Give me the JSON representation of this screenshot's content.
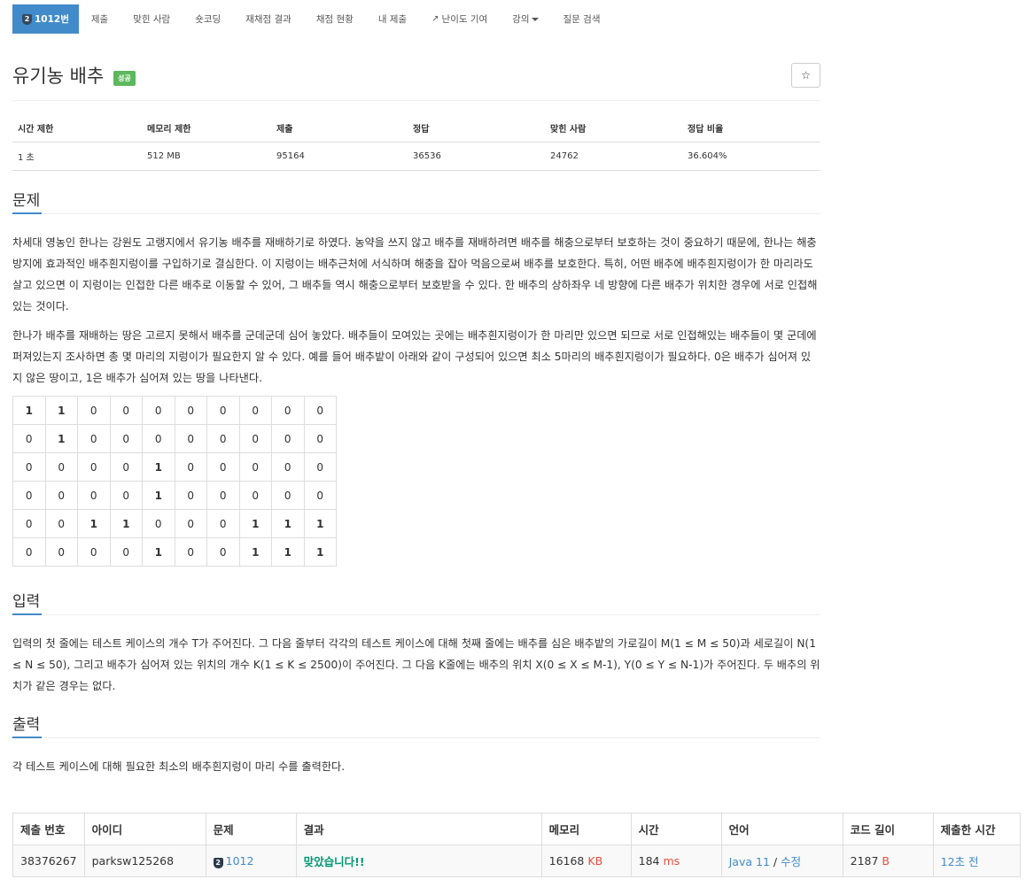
{
  "nav": {
    "items": [
      {
        "label": "1012번",
        "badge": "2",
        "active": true
      },
      {
        "label": "제출"
      },
      {
        "label": "맞힌 사람"
      },
      {
        "label": "숏코딩"
      },
      {
        "label": "재채점 결과"
      },
      {
        "label": "채점 현황"
      },
      {
        "label": "내 제출"
      },
      {
        "label": "난이도 기여",
        "icon": "external-link-icon"
      },
      {
        "label": "강의",
        "dropdown": true
      },
      {
        "label": "질문 검색"
      }
    ]
  },
  "problem": {
    "title": "유기농 배추",
    "status_label": "성공",
    "star": "☆"
  },
  "info": {
    "headers": [
      "시간 제한",
      "메모리 제한",
      "제출",
      "정답",
      "맞힌 사람",
      "정답 비율"
    ],
    "values": [
      "1 초",
      "512 MB",
      "95164",
      "36536",
      "24762",
      "36.604%"
    ]
  },
  "sections": {
    "description": {
      "heading": "문제",
      "p1": "차세대 영농인 한나는 강원도 고랭지에서 유기농 배추를 재배하기로 하였다. 농약을 쓰지 않고 배추를 재배하려면 배추를 해충으로부터 보호하는 것이 중요하기 때문에, 한나는 해충 방지에 효과적인 배추흰지렁이를 구입하기로 결심한다. 이 지렁이는 배추근처에 서식하며 해충을 잡아 먹음으로써 배추를 보호한다. 특히, 어떤 배추에 배추흰지렁이가 한 마리라도 살고 있으면 이 지렁이는 인접한 다른 배추로 이동할 수 있어, 그 배추들 역시 해충으로부터 보호받을 수 있다. 한 배추의 상하좌우 네 방향에 다른 배추가 위치한 경우에 서로 인접해있는 것이다.",
      "p2": "한나가 배추를 재배하는 땅은 고르지 못해서 배추를 군데군데 심어 놓았다. 배추들이 모여있는 곳에는 배추흰지렁이가 한 마리만 있으면 되므로 서로 인접해있는 배추들이 몇 군데에 퍼져있는지 조사하면 총 몇 마리의 지렁이가 필요한지 알 수 있다. 예를 들어 배추밭이 아래와 같이 구성되어 있으면 최소 5마리의 배추흰지렁이가 필요하다. 0은 배추가 심어져 있지 않은 땅이고, 1은 배추가 심어져 있는 땅을 나타낸다."
    },
    "input": {
      "heading": "입력",
      "p1": "입력의 첫 줄에는 테스트 케이스의 개수 T가 주어진다. 그 다음 줄부터 각각의 테스트 케이스에 대해 첫째 줄에는 배추를 심은 배추밭의 가로길이 M(1 ≤ M ≤ 50)과 세로길이 N(1 ≤ N ≤ 50), 그리고 배추가 심어져 있는 위치의 개수 K(1 ≤ K ≤ 2500)이 주어진다. 그 다음 K줄에는 배추의 위치 X(0 ≤ X ≤ M-1), Y(0 ≤ Y ≤ N-1)가 주어진다. 두 배추의 위치가 같은 경우는 없다."
    },
    "output": {
      "heading": "출력",
      "p1": "각 테스트 케이스에 대해 필요한 최소의 배추흰지렁이 마리 수를 출력한다."
    }
  },
  "grid": [
    [
      "1",
      "1",
      "0",
      "0",
      "0",
      "0",
      "0",
      "0",
      "0",
      "0"
    ],
    [
      "0",
      "1",
      "0",
      "0",
      "0",
      "0",
      "0",
      "0",
      "0",
      "0"
    ],
    [
      "0",
      "0",
      "0",
      "0",
      "1",
      "0",
      "0",
      "0",
      "0",
      "0"
    ],
    [
      "0",
      "0",
      "0",
      "0",
      "1",
      "0",
      "0",
      "0",
      "0",
      "0"
    ],
    [
      "0",
      "0",
      "1",
      "1",
      "0",
      "0",
      "0",
      "1",
      "1",
      "1"
    ],
    [
      "0",
      "0",
      "0",
      "0",
      "1",
      "0",
      "0",
      "1",
      "1",
      "1"
    ]
  ],
  "submission": {
    "headers": [
      "제출 번호",
      "아이디",
      "문제",
      "결과",
      "메모리",
      "시간",
      "언어",
      "코드 길이",
      "제출한 시간"
    ],
    "id": "38376267",
    "user": "parksw125268",
    "problem_badge": "2",
    "problem": "1012",
    "result": "맞았습니다!!",
    "memory": "16168",
    "memory_unit": "KB",
    "time": "184",
    "time_unit": "ms",
    "language": "Java 11",
    "separator": " / ",
    "edit": "수정",
    "code_length": "2187",
    "code_length_unit": "B",
    "submitted": "12초 전"
  },
  "colors": {
    "primary": "#428bca",
    "success_label": "#5cb85c",
    "result_ok": "#009874",
    "unit": "#e74c3c"
  }
}
